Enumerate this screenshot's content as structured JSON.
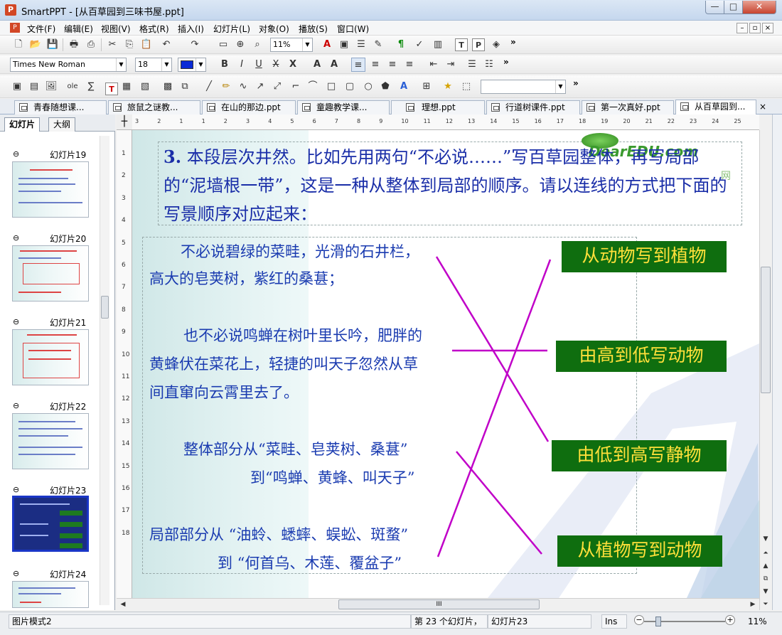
{
  "window": {
    "title": "SmartPPT - [从百草园到三味书屋.ppt]",
    "app_icon": "P",
    "min": "—",
    "max": "□",
    "close": "✕"
  },
  "menu": {
    "items": [
      "文件(F)",
      "编辑(E)",
      "视图(V)",
      "格式(R)",
      "插入(I)",
      "幻灯片(L)",
      "对象(O)",
      "播放(S)",
      "窗口(W)"
    ],
    "mdi": [
      "–",
      "▫",
      "×"
    ]
  },
  "toolbar": {
    "zoom": "11%",
    "font_name": "Times New Roman",
    "font_size": "18",
    "font_color": "#0a2ad6",
    "more": "»"
  },
  "tabs": [
    {
      "label": "青春随想课..."
    },
    {
      "label": "旅鼠之谜教..."
    },
    {
      "label": "在山的那边.ppt"
    },
    {
      "label": "童趣教学课..."
    },
    {
      "label": "理想.ppt"
    },
    {
      "label": "行道树课件.ppt"
    },
    {
      "label": "第一次真好.ppt"
    },
    {
      "label": "从百草园到..."
    }
  ],
  "tab_close": "×",
  "side": {
    "tab_slides": "幻灯片",
    "tab_outline": "大纲",
    "slides": [
      {
        "label": "幻灯片19"
      },
      {
        "label": "幻灯片20"
      },
      {
        "label": "幻灯片21"
      },
      {
        "label": "幻灯片22"
      },
      {
        "label": "幻灯片23"
      },
      {
        "label": "幻灯片24"
      }
    ]
  },
  "ruler": {
    "h_marks": [
      "3",
      "2",
      "1",
      "1",
      "2",
      "3",
      "4",
      "5",
      "6",
      "7",
      "8",
      "9",
      "10",
      "11",
      "12",
      "13",
      "14",
      "15",
      "16",
      "17",
      "18",
      "19",
      "20",
      "21",
      "22",
      "23",
      "24",
      "25"
    ],
    "v_marks": [
      "1",
      "2",
      "3",
      "4",
      "5",
      "6",
      "7",
      "8",
      "9",
      "10",
      "11",
      "12",
      "13",
      "14",
      "15",
      "16",
      "17",
      "18"
    ]
  },
  "slide": {
    "heading_num": "3.",
    "heading": "本段层次井然。比如先用两句“不必说……”写百草园整体，再写局部的“泥墙根一带”，这是一种从整体到局部的顺序。请以连线的方式把下面的写景顺序对应起来：",
    "para1_line1": "不必说碧绿的菜畦，光滑的石井栏，",
    "para1_line2": "高大的皂荚树，紫红的桑葚；",
    "para2_line1": "也不必说鸣蝉在树叶里长吟，肥胖的",
    "para2_line2": "黄蜂伏在菜花上，轻捷的叫天子忽然从草",
    "para2_line3": "间直窜向云霄里去了。",
    "para3_line1": "整体部分从“菜畦、皂荚树、桑葚”",
    "para3_line2": "到“鸣蝉、黄蜂、叫天子”",
    "para4_line1": "局部部分从 “油蛉、蟋蟀、蜈蚣、斑蝥”",
    "para4_line2": "到 “何首乌、木莲、覆盆子”",
    "box1": "从动物写到植物",
    "box2": "由高到低写动物",
    "box3": "由低到高写静物",
    "box4": "从植物写到动物",
    "watermark": "DearEDU.com",
    "watermark_net": "网",
    "line_color": "#c000c8",
    "box_bg": "#0f6e0f",
    "box_fg": "#ffe03a"
  },
  "scroll": {
    "hs_grip": "III"
  },
  "status": {
    "mode": "图片模式2",
    "position": "第 23 个幻灯片，",
    "slide_name": "幻灯片23",
    "ins": "Ins",
    "zoom": "11%"
  }
}
